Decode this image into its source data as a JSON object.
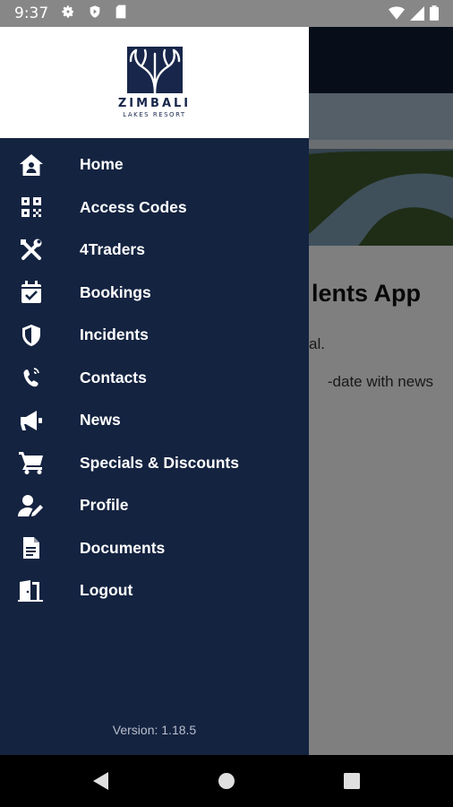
{
  "status_bar": {
    "time": "9:37",
    "left_icons": [
      "gear-icon",
      "shield-play-icon",
      "sd-card-icon"
    ],
    "right_icons": [
      "wifi-icon",
      "cell-signal-icon",
      "battery-icon"
    ]
  },
  "background": {
    "title_fragment": "lents App",
    "text_line1": "al.",
    "text_line2": "-date with news"
  },
  "drawer": {
    "logo": {
      "name": "ZIMBALI",
      "subtitle": "LAKES RESORT"
    },
    "menu": [
      {
        "label": "Home",
        "icon": "home-icon"
      },
      {
        "label": "Access Codes",
        "icon": "qr-code-icon"
      },
      {
        "label": "4Traders",
        "icon": "tools-icon"
      },
      {
        "label": "Bookings",
        "icon": "calendar-check-icon"
      },
      {
        "label": "Incidents",
        "icon": "shield-icon"
      },
      {
        "label": "Contacts",
        "icon": "phone-icon"
      },
      {
        "label": "News",
        "icon": "megaphone-icon"
      },
      {
        "label": "Specials & Discounts",
        "icon": "cart-icon"
      },
      {
        "label": "Profile",
        "icon": "user-edit-icon"
      },
      {
        "label": "Documents",
        "icon": "document-icon"
      },
      {
        "label": "Logout",
        "icon": "door-exit-icon"
      }
    ],
    "version": "Version: 1.18.5"
  },
  "nav_bar": {
    "buttons": [
      "back-icon",
      "home-circle-icon",
      "recents-icon"
    ]
  },
  "colors": {
    "drawer_bg": "#142340",
    "status_bar": "#878787",
    "logo": "#17264a"
  }
}
